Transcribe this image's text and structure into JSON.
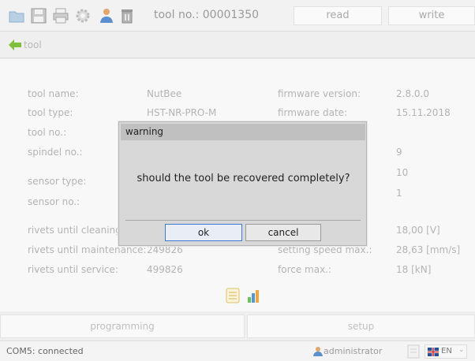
{
  "toolbar": {
    "title": "tool no.: 00001350",
    "read_label": "read",
    "write_label": "write",
    "icons": [
      "folder-icon",
      "save-icon",
      "printer-icon",
      "gear-icon",
      "user-icon",
      "trash-icon"
    ]
  },
  "breadcrumb": {
    "label": "tool"
  },
  "details": {
    "left": [
      {
        "label": "tool name:",
        "value": "NutBee"
      },
      {
        "label": "tool type:",
        "value": "HST-NR-PRO-M"
      },
      {
        "label": "tool no.:",
        "value": ""
      },
      {
        "label": "spindel no.:",
        "value": ""
      },
      {
        "label": "sensor type:",
        "value": ""
      },
      {
        "label": "sensor no.:",
        "value": ""
      },
      {
        "label": "rivets until cleaning",
        "value": ""
      },
      {
        "label": "rivets until maintenance:",
        "value": "249826"
      },
      {
        "label": "rivets until service:",
        "value": "499826"
      }
    ],
    "right": [
      {
        "label": "firmware version:",
        "value": "2.8.0.0"
      },
      {
        "label": "firmware date:",
        "value": "15.11.2018"
      },
      {
        "label": "",
        "value": ""
      },
      {
        "label": "",
        "value": "9"
      },
      {
        "label": "",
        "value": "10"
      },
      {
        "label": "",
        "value": "1"
      },
      {
        "label": "",
        "value": "18,00 [V]"
      },
      {
        "label": "setting speed max.:",
        "value": "28,63 [mm/s]"
      },
      {
        "label": "force max.:",
        "value": "18 [kN]"
      }
    ]
  },
  "tabs": {
    "programming": "programming",
    "setup": "setup"
  },
  "status": {
    "connection": "COM5: connected",
    "user": "administrator",
    "language": "EN"
  },
  "dialog": {
    "title": "warning",
    "message": "should the tool be recovered completely?",
    "ok_label": "ok",
    "cancel_label": "cancel"
  },
  "colors": {
    "accent": "#3b7bd4",
    "dialog_bg": "#d8d8d8",
    "dialog_title": "#c0c0c0"
  }
}
